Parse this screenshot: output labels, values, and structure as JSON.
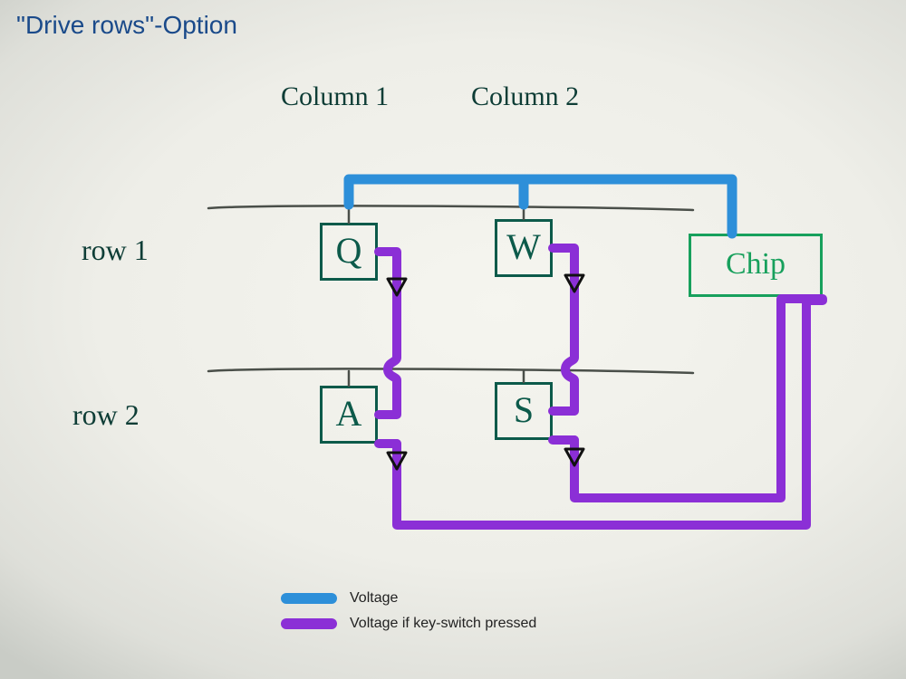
{
  "title": "\"Drive rows\"-Option",
  "columns": {
    "c1": "Column 1",
    "c2": "Column 2"
  },
  "rows": {
    "r1": "row 1",
    "r2": "row 2"
  },
  "keys": {
    "q": "Q",
    "w": "W",
    "a": "A",
    "s": "S"
  },
  "chip": "Chip",
  "legend": {
    "voltage": "Voltage",
    "voltage_pressed": "Voltage if key-switch pressed"
  },
  "colors": {
    "voltage": "#2d8fd9",
    "voltage_pressed": "#8b2fd6",
    "pencil": "#4a4f49",
    "ink": "#0c5a4a",
    "chip": "#17a05c"
  },
  "chart_data": {
    "type": "table",
    "title": "\"Drive rows\"-Option keyboard matrix",
    "rows": [
      "row 1",
      "row 2"
    ],
    "columns": [
      "Column 1",
      "Column 2"
    ],
    "cells": [
      [
        "Q",
        "W"
      ],
      [
        "A",
        "S"
      ]
    ],
    "controller": "Chip",
    "signals": [
      {
        "name": "Voltage",
        "color": "#2d8fd9",
        "description": "Row drive voltage from chip along row 1"
      },
      {
        "name": "Voltage if key-switch pressed",
        "color": "#8b2fd6",
        "description": "Return path down columns through diodes back to chip when key is pressed"
      }
    ]
  }
}
